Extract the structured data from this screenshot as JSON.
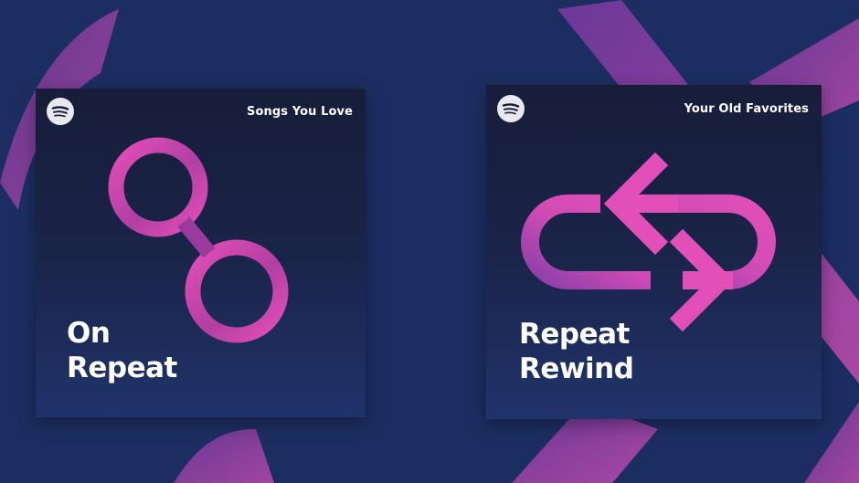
{
  "colors": {
    "background": "#1c2e61",
    "accent_pink": "#e24fb8",
    "accent_purple": "#8a3fa8",
    "cover_dark": "#171d39",
    "text": "#ffffff"
  },
  "covers": [
    {
      "logo_icon": "spotify-logo-icon",
      "subtitle": "Songs You Love",
      "title_line1": "On",
      "title_line2": "Repeat",
      "artwork_icon": "infinity-loop-icon"
    },
    {
      "logo_icon": "spotify-logo-icon",
      "subtitle": "Your Old Favorites",
      "title_line1": "Repeat",
      "title_line2": "Rewind",
      "artwork_icon": "rewind-arrows-icon"
    }
  ]
}
